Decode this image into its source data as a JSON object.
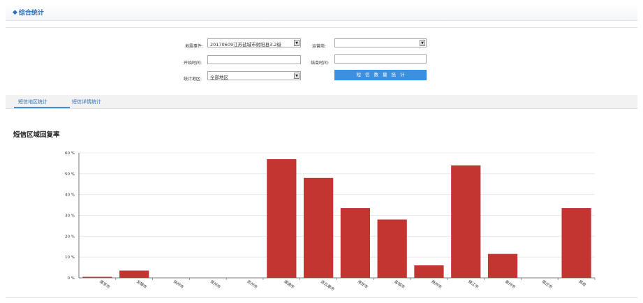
{
  "header": {
    "icon": "diamond-arrow-icon",
    "title": "综合统计"
  },
  "form": {
    "event_label": "地震事件:",
    "event_value": "20170609江苏盐城市射阳县3.2级",
    "operator_label": "运营商:",
    "operator_value": "",
    "start_label": "开始时间:",
    "start_value": "",
    "end_label": "结束时间:",
    "end_value": "",
    "region_label": "统计地区:",
    "region_value": "全部地区",
    "submit_label": "短信数量统计"
  },
  "tabs": [
    {
      "label": "短信地区统计",
      "active": true
    },
    {
      "label": "短信详情统计",
      "active": false
    }
  ],
  "chart_title": "短信区域回复率",
  "colors": {
    "bar": "#c23531",
    "accent": "#3d8fe0",
    "link": "#2f6fb5"
  },
  "chart_data": {
    "type": "bar",
    "title": "短信区域回复率",
    "categories": [
      "南京市",
      "无锡市",
      "徐州市",
      "常州市",
      "苏州市",
      "南通市",
      "连云港市",
      "淮安市",
      "盐城市",
      "扬州市",
      "镇江市",
      "泰州市",
      "宿迁市",
      "其他"
    ],
    "values": [
      0.5,
      3.5,
      0,
      0,
      0,
      57,
      48,
      33.5,
      28,
      6,
      54,
      11.5,
      0,
      33.5
    ],
    "yticks": [
      "0 %",
      "10 %",
      "20 %",
      "30 %",
      "40 %",
      "50 %",
      "60 %"
    ],
    "ylim": [
      0,
      60
    ],
    "grid": true
  }
}
